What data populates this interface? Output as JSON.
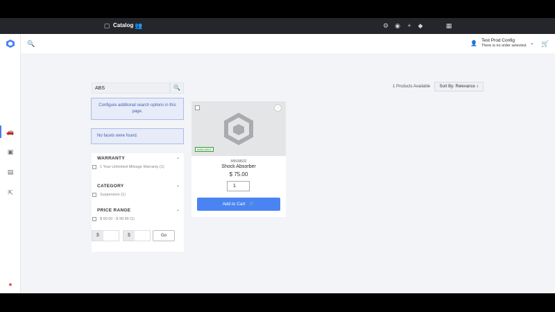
{
  "topbar": {
    "title": "Catalog",
    "icons": [
      "sidebar-toggle-icon",
      "user-group-icon",
      "settings-icon",
      "eye-icon",
      "plus-icon",
      "diamond-icon",
      "grid-icon"
    ]
  },
  "header": {
    "search_icon": "search-icon",
    "account_name": "Test Prod Config",
    "account_status": "There is no order selected.",
    "cart_icon": "cart-icon"
  },
  "search": {
    "value": "ABS"
  },
  "notices": {
    "configure": "Configure additional search options in this page.",
    "no_facets": "No facets were found."
  },
  "facets": [
    {
      "title": "WARRANTY",
      "options": [
        "1 Year Unlimited Mileage Warranty (1)"
      ]
    },
    {
      "title": "CATEGORY",
      "options": [
        "Suspension (1)"
      ]
    },
    {
      "title": "PRICE RANGE",
      "options": [
        "$ 50.00 - $ 99.99 (1)"
      ]
    }
  ],
  "price_filter": {
    "currency_symbol": "$",
    "go_label": "Go"
  },
  "results": {
    "available": "1 Products Available",
    "sort_label": "Sort By: Relevance ↕"
  },
  "product": {
    "sku": "MIN38602",
    "name": "Shock Absorber",
    "price": "$ 75.00",
    "quantity": "1",
    "add_label": "Add to Cart",
    "tag": "AVAILABLE"
  },
  "colors": {
    "accent": "#4a84f2",
    "topbar": "#25262b",
    "notice_bg": "#e7ecf8"
  }
}
